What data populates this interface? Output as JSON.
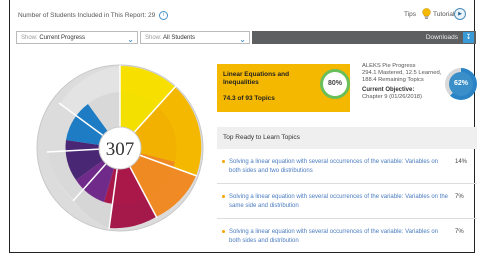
{
  "header": {
    "students_label": "Number of Students Included in This Report: 29",
    "info_icon": "info-icon",
    "tips_label": "Tips",
    "tutorial_label": "Tutorial"
  },
  "filters": {
    "show_label_1": "Show:",
    "progress_value": "Current Progress",
    "show_label_2": "Show:",
    "students_value": "All Students",
    "downloads_label": "Downloads"
  },
  "pie": {
    "center_value": "307"
  },
  "topic_card": {
    "title": "Linear Equations and Inequalities",
    "count": "74.3 of 93 Topics",
    "percent": "80%",
    "accent": "#f5b800"
  },
  "pie_progress": {
    "title": "ALEKS Pie Progress",
    "detail_line1": "294.1 Mastered, 12.5 Learned,",
    "detail_line2": "188.4 Remaining Topics",
    "objective_label": "Current Objective:",
    "objective_value": "Chapter 9 (01/26/2018)",
    "percent": "62%"
  },
  "ready": {
    "title": "Top Ready to Learn Topics",
    "items": [
      {
        "text": "Solving a linear equation with several occurrences of the variable: Variables on both sides and two distributions",
        "pct": "14%"
      },
      {
        "text": "Solving a linear equation with several occurrences of the variable: Variables on the same side and distribution",
        "pct": "7%"
      },
      {
        "text": "Solving a linear equation with several occurrences of the variable: Variables on both sides and distribution",
        "pct": "7%"
      }
    ]
  }
}
